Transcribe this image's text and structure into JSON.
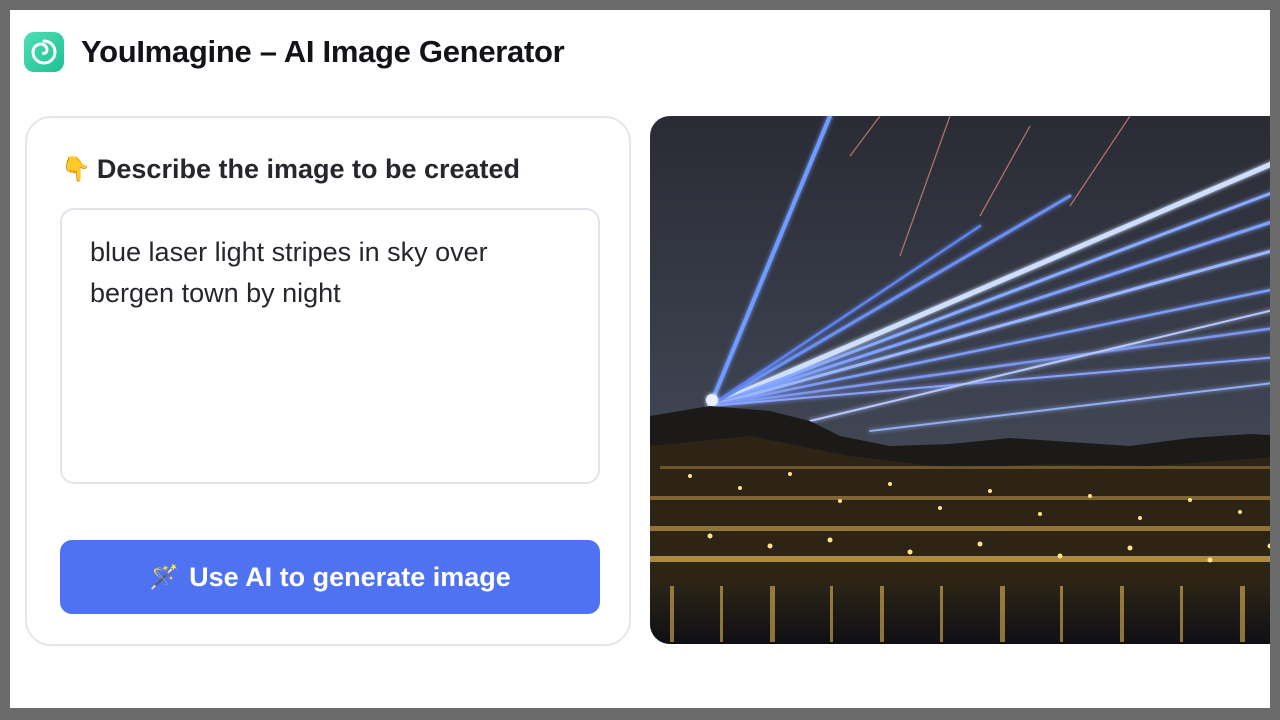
{
  "header": {
    "logo_icon": "swirl-logo-icon",
    "title": "YouImagine – AI Image Generator"
  },
  "prompt_card": {
    "pointer_icon": "pointing-down-hand-icon",
    "heading": "Describe the image to be created",
    "prompt_value": "blue laser light stripes in sky over bergen town by night",
    "button_icon": "magic-wand-icon",
    "button_label": "Use AI to generate image"
  },
  "colors": {
    "accent": "#4f72f2",
    "logo": "#2fcfa3",
    "title": "#111318"
  }
}
